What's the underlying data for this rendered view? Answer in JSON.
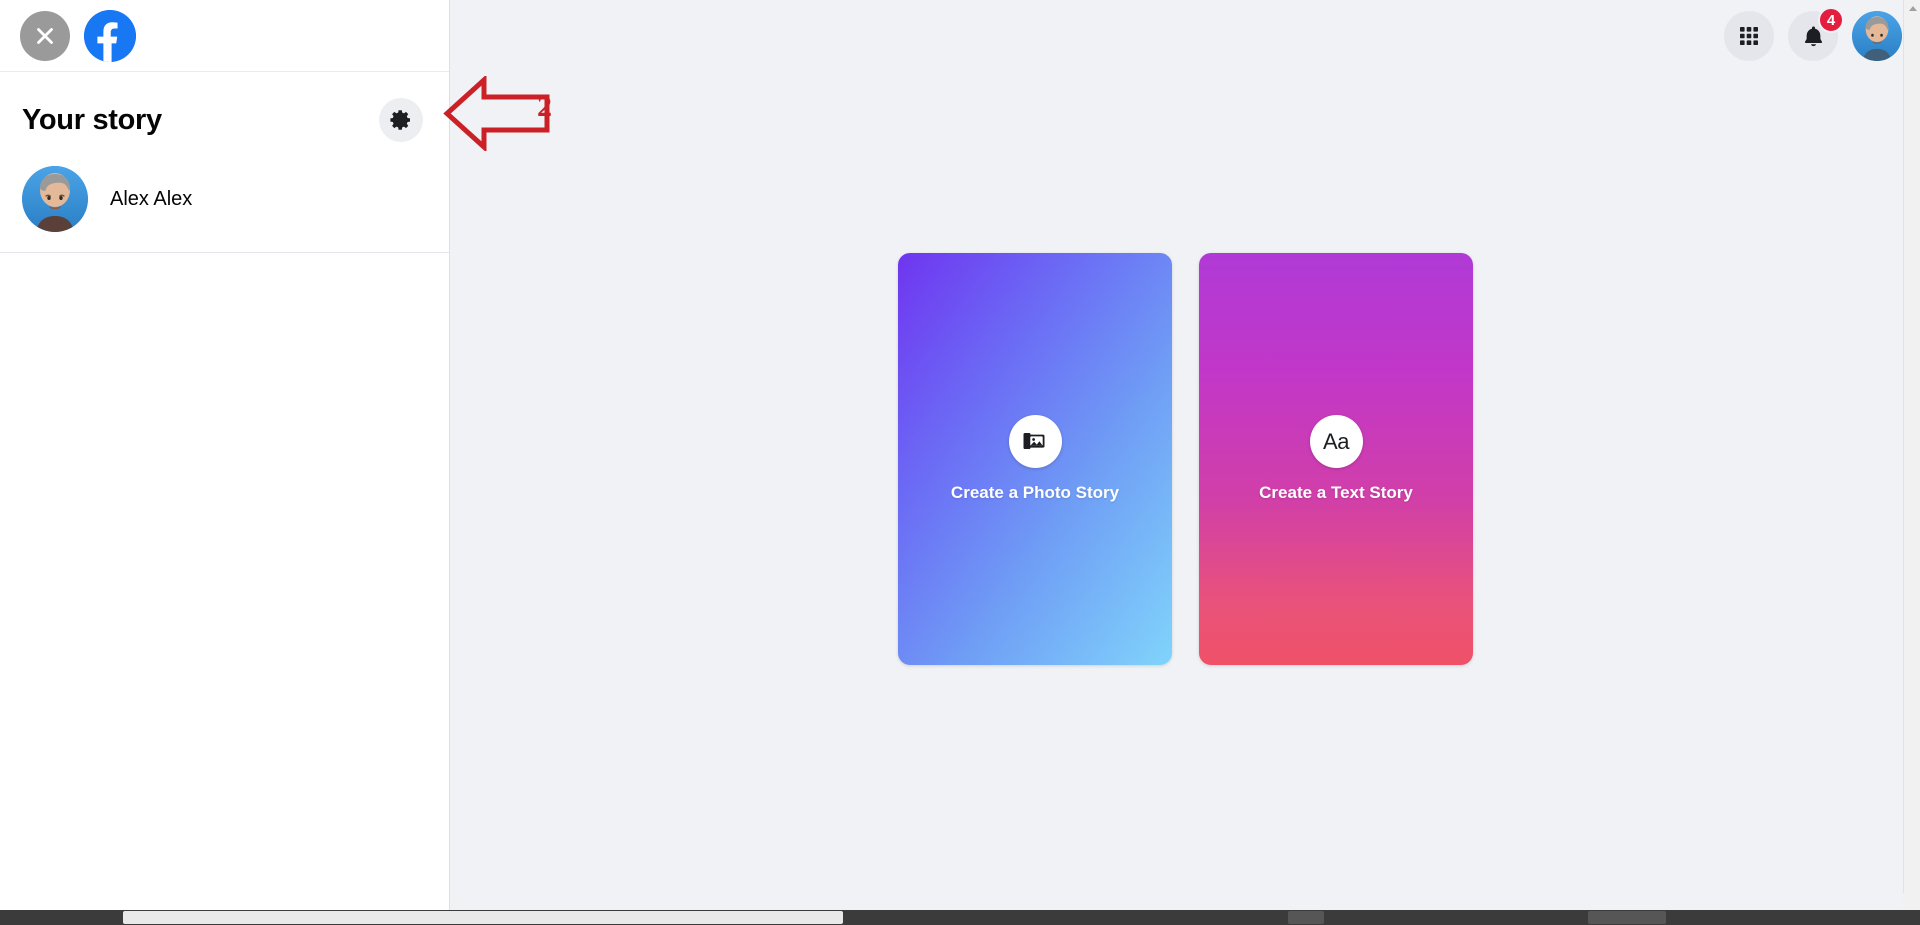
{
  "window": {
    "background_color": "#f0f2f5"
  },
  "sidebar": {
    "close_button": {
      "icon": "close-x-icon",
      "label": "Close"
    },
    "brand": {
      "icon": "facebook-logo-icon",
      "label": "Facebook",
      "color": "#1877f2"
    },
    "title": "Your story",
    "settings_button": {
      "icon": "gear-icon",
      "label": "Story settings"
    },
    "user": {
      "name": "Alex Alex",
      "avatar": "user-avatar"
    }
  },
  "header": {
    "apps_button": {
      "icon": "grid-apps-icon",
      "label": "Menu"
    },
    "notifications_button": {
      "icon": "bell-icon",
      "label": "Notifications",
      "badge_count": "4",
      "badge_color": "#e41e3f"
    },
    "account_button": {
      "icon": "avatar-icon",
      "label": "Account"
    }
  },
  "main": {
    "cards": [
      {
        "id": "photo-story",
        "label": "Create a Photo Story",
        "icon": "photo-gallery-icon",
        "icon_text": "",
        "gradient_from": "#6f35f0",
        "gradient_to": "#80d4fb"
      },
      {
        "id": "text-story",
        "label": "Create a Text Story",
        "icon": "text-aa-icon",
        "icon_text": "Aa",
        "gradient_from": "#b03ad6",
        "gradient_to": "#ef5167"
      }
    ]
  },
  "annotation": {
    "step_number": "2",
    "color": "#cc2027",
    "points_to": "settings-gear-button"
  }
}
